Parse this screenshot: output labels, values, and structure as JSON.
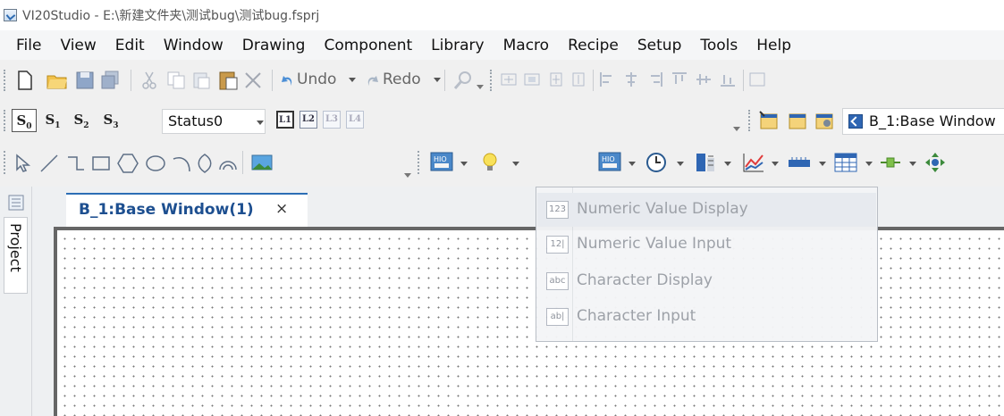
{
  "window": {
    "title": "VI20Studio - E:\\新建文件夹\\测试bug\\测试bug.fsprj"
  },
  "menu": [
    "File",
    "View",
    "Edit",
    "Window",
    "Drawing",
    "Component",
    "Library",
    "Macro",
    "Recipe",
    "Setup",
    "Tools",
    "Help"
  ],
  "toolbar1": {
    "undo_label": "Undo",
    "redo_label": "Redo"
  },
  "toolbar2": {
    "status_buttons": [
      "S0",
      "S1",
      "S2",
      "S3"
    ],
    "status_select_value": "Status0",
    "layer_buttons": [
      "L1",
      "L2",
      "L3",
      "L4"
    ],
    "window_select_value": "B_1:Base Window"
  },
  "toolbar3": {
    "numeric_button_label": "123"
  },
  "sidebar": {
    "project_tab": "Project"
  },
  "document": {
    "tab_label": "B_1:Base Window(1)",
    "close_glyph": "×"
  },
  "dropdown": {
    "items": [
      {
        "icon_text": "123",
        "label": "Numeric Value Display"
      },
      {
        "icon_text": "12|",
        "label": "Numeric Value Input"
      },
      {
        "icon_text": "abc",
        "label": "Character Display"
      },
      {
        "icon_text": "ab|",
        "label": "Character Input"
      }
    ]
  },
  "colors": {
    "accent": "#2c6eb5",
    "hover_button": "#fde7a6",
    "tab_text": "#1d4f90"
  }
}
